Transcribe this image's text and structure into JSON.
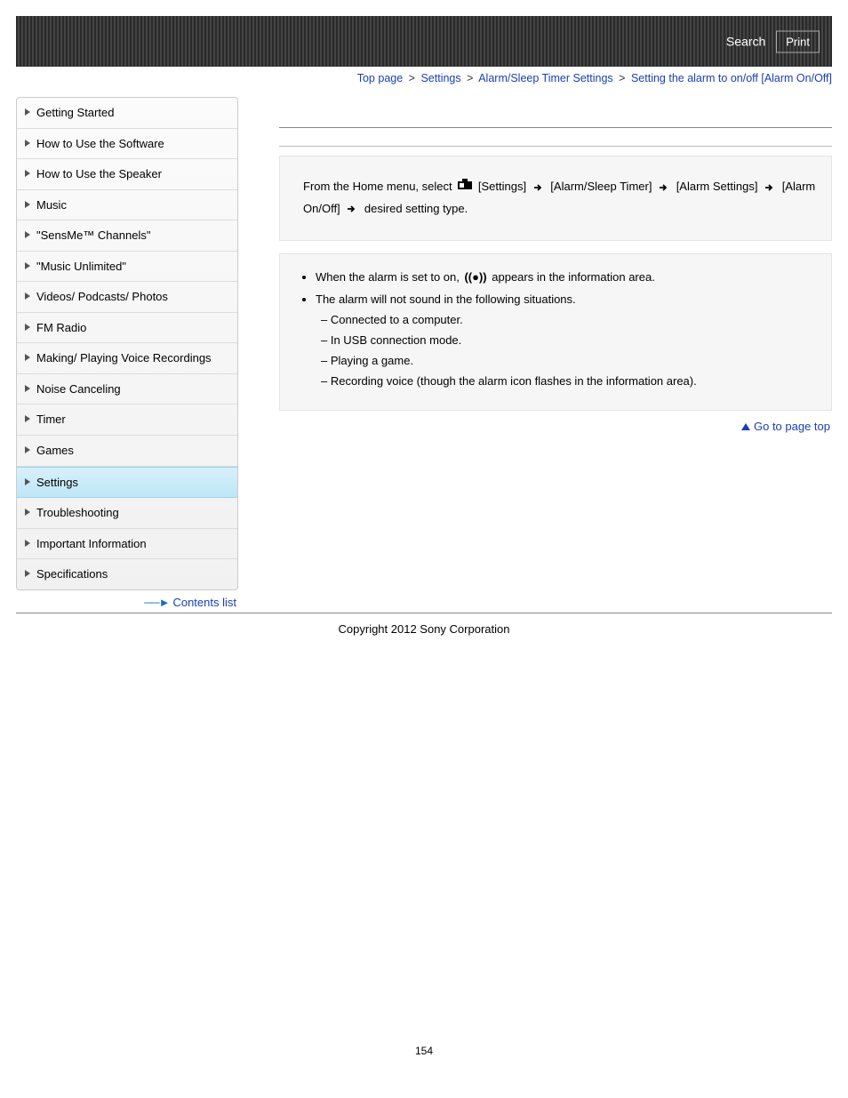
{
  "header": {
    "search_label": "Search",
    "print_label": "Print"
  },
  "breadcrumb": {
    "items": [
      "Top page",
      "Settings",
      "Alarm/Sleep Timer Settings",
      "Setting the alarm to on/off [Alarm On/Off]"
    ]
  },
  "sidebar": {
    "items": [
      {
        "label": "Getting Started"
      },
      {
        "label": "How to Use the Software"
      },
      {
        "label": "How to Use the Speaker"
      },
      {
        "label": "Music"
      },
      {
        "label": "\"SensMe™ Channels\""
      },
      {
        "label": "\"Music Unlimited\""
      },
      {
        "label": "Videos/ Podcasts/ Photos"
      },
      {
        "label": "FM Radio"
      },
      {
        "label": "Making/ Playing Voice Recordings"
      },
      {
        "label": "Noise Canceling"
      },
      {
        "label": "Timer"
      },
      {
        "label": "Games"
      },
      {
        "label": "Settings"
      },
      {
        "label": "Troubleshooting"
      },
      {
        "label": "Important Information"
      },
      {
        "label": "Specifications"
      }
    ],
    "active_index": 12,
    "contents_list_label": "Contents list"
  },
  "content": {
    "instruction_prefix": "From the Home menu, select ",
    "settings_label": " [Settings] ",
    "path2": " [Alarm/Sleep Timer] ",
    "path3": " [Alarm Settings] ",
    "path4": " [Alarm On/Off] ",
    "final": " desired setting type.",
    "notes": {
      "n1a": "When the alarm is set to on, ",
      "n1b": " appears in the information area.",
      "n2": "The alarm will not sound in the following situations.",
      "sub": [
        "Connected to a computer.",
        "In USB connection mode.",
        "Playing a game.",
        "Recording voice (though the alarm icon flashes in the information area)."
      ]
    },
    "gotop_label": "Go to page top"
  },
  "footer": {
    "copyright": "Copyright 2012 Sony Corporation",
    "page_number": "154"
  }
}
